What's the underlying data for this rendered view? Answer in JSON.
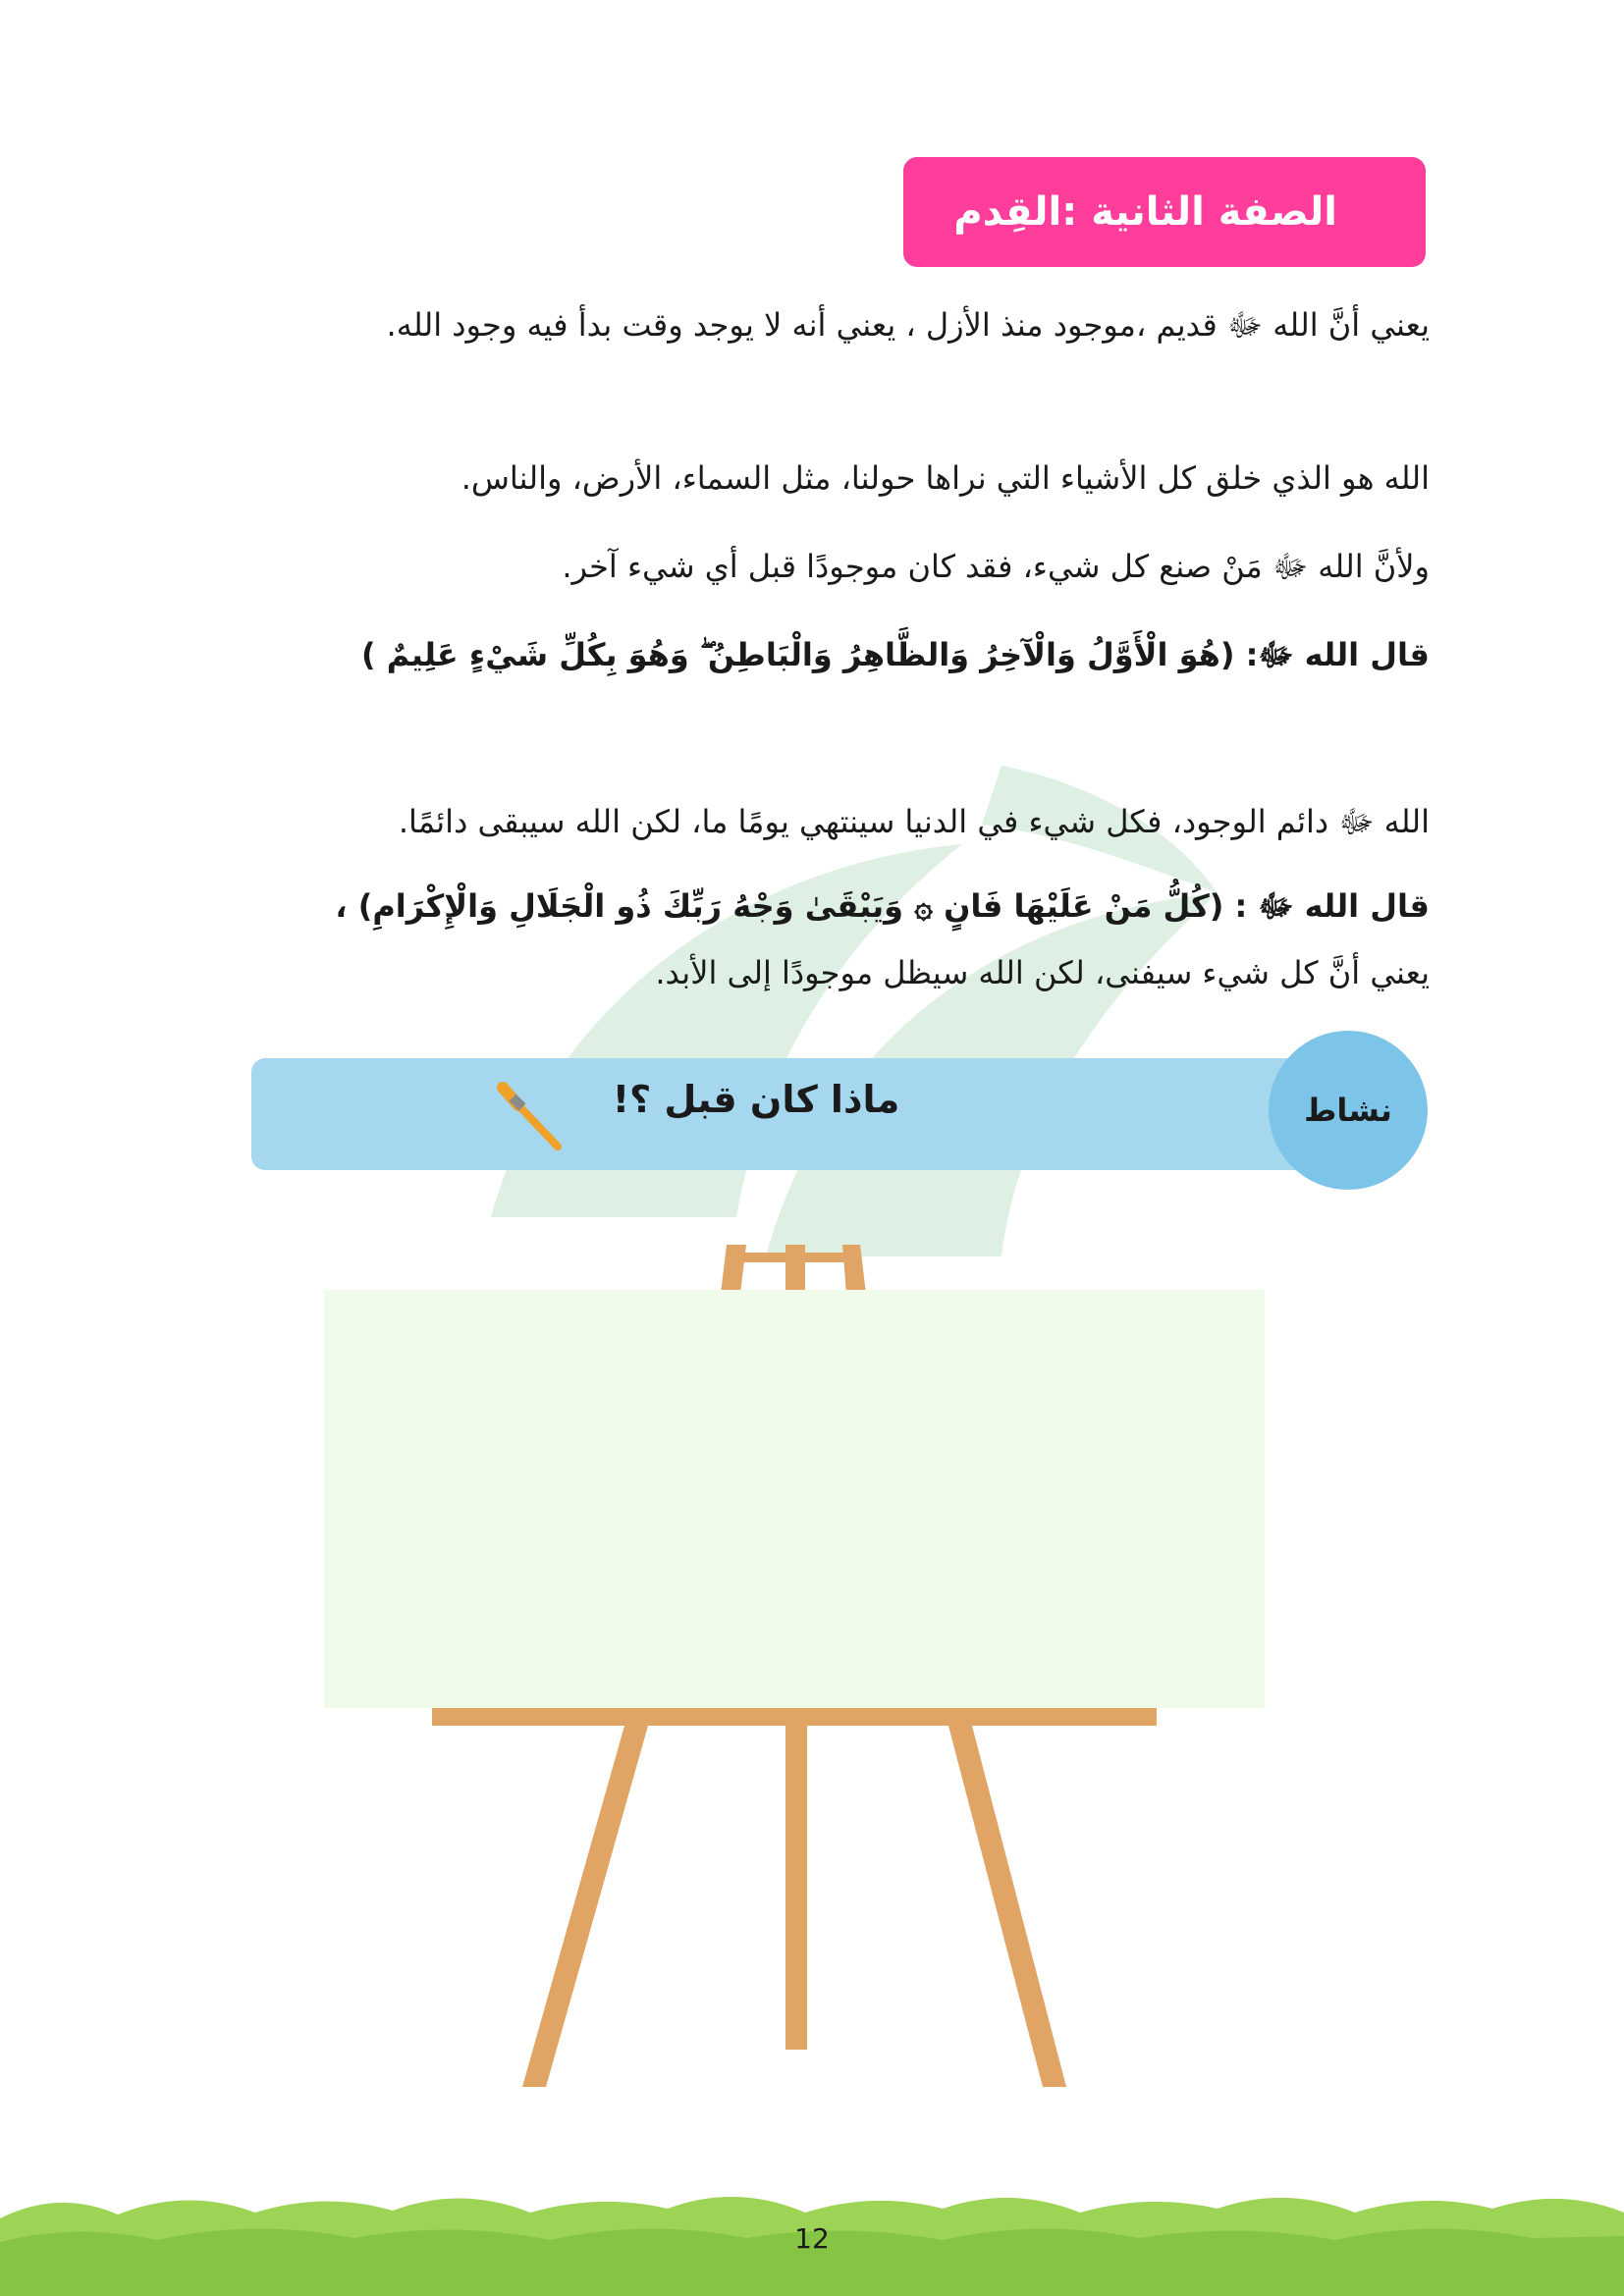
{
  "title": "الصفة الثانية :القِدم",
  "paragraphs": {
    "p1": "يعني أنَّ الله ﷻ قديم ،موجود منذ الأزل ، يعني أنه لا يوجد وقت بدأ فيه وجود الله.",
    "p2": "الله هو الذي خلق كل الأشياء التي نراها حولنا، مثل السماء، الأرض، والناس.",
    "p3": "ولأنَّ الله ﷻ مَنْ صنع كل شيء، فقد كان موجودًا قبل أي شيء آخر.",
    "verse1": "قال الله ﷻ: (هُوَ الْأَوَّلُ وَالْآخِرُ وَالظَّاهِرُ وَالْبَاطِنُ ۖ وَهُوَ بِكُلِّ شَيْءٍ عَلِيمٌ )",
    "p4": "الله ﷻ دائم الوجود، فكل شيء في الدنيا سينتهي يومًا ما، لكن الله سيبقى دائمًا.",
    "verse2": "قال الله ﷻ : (كُلُّ مَنْ عَلَيْهَا فَانٍ ۞ وَيَبْقَىٰ وَجْهُ رَبِّكَ ذُو الْجَلَالِ وَالْإِكْرَامِ) ،",
    "p5": "يعني أنَّ كل شيء سيفنى، لكن الله سيظل موجودًا إلى الأبد."
  },
  "activity": {
    "label": "نشاط",
    "title": "ماذا كان قبل ؟!",
    "icon": "paintbrush-icon"
  },
  "page_number": "12",
  "colors": {
    "title_bg": "#ff3d9a",
    "activity_bar": "#a5d7ee",
    "activity_circle": "#7cc5e8",
    "easel_wood": "#e0a464",
    "canvas": "#f1fbe9",
    "grass": "#9dd456"
  }
}
